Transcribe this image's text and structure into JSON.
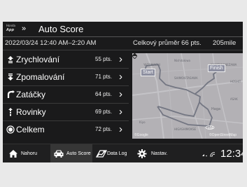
{
  "header": {
    "logo_small": "Honda",
    "logo_main": "App",
    "crumb": "»",
    "title": "Auto Score"
  },
  "subheader": {
    "datetime": "2022/03/24 12:40 AM–2:20 AM",
    "average": "Celkový průměr 66 pts.",
    "distance": "205mile"
  },
  "scores": [
    {
      "icon": "acceleration-icon",
      "label": "Zrychlování",
      "pts": "55 pts."
    },
    {
      "icon": "braking-icon",
      "label": "Zpomalování",
      "pts": "71 pts."
    },
    {
      "icon": "cornering-icon",
      "label": "Zatáčky",
      "pts": "64 pts."
    },
    {
      "icon": "straight-icon",
      "label": "Rovinky",
      "pts": "69 pts."
    },
    {
      "icon": "total-icon",
      "label": "Celkem",
      "pts": "72 pts."
    }
  ],
  "map": {
    "start_label": "Start",
    "finish_label": "Finish",
    "labels": [
      "YAZOMACHI",
      "Nishitokiwa",
      "SHIMOKITASAWA",
      "KAMITAKANEZAWA",
      "HOSHIT",
      "ASAK",
      "Haga",
      "HIGASHIMOKSE",
      "Kiyo"
    ],
    "attribution_left": "©Google",
    "attribution_right": "©OpenStreetMap",
    "road_number": "154",
    "route_color": "#737682"
  },
  "bottom_bar": {
    "tabs": [
      {
        "icon": "home-icon",
        "label": "Nahoru"
      },
      {
        "icon": "car-icon",
        "label": "Auto Score"
      },
      {
        "icon": "data-log-icon",
        "label": "Data Log"
      },
      {
        "icon": "settings-icon",
        "label": "Nastav."
      }
    ],
    "active_tab": "Auto Score",
    "time": "12:34"
  }
}
